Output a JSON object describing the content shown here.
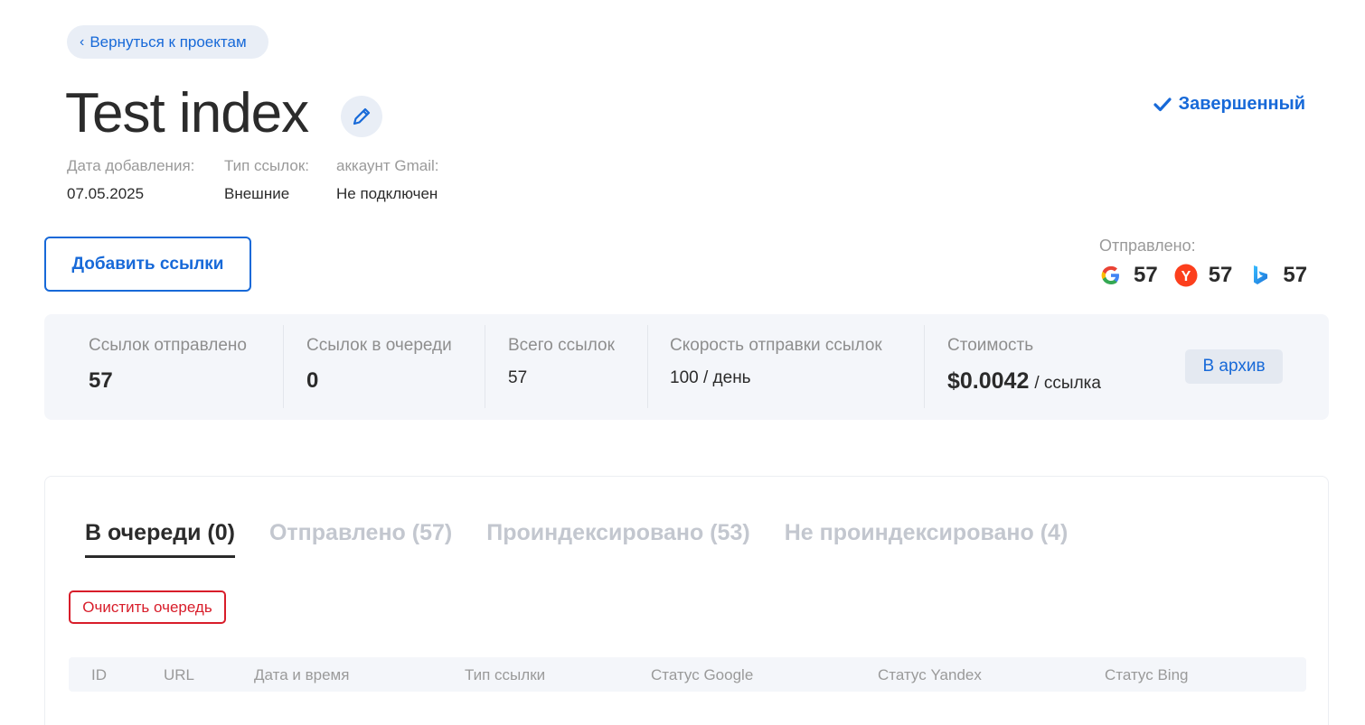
{
  "nav": {
    "back_label": "Вернуться к проектам"
  },
  "project": {
    "title": "Test index",
    "status": "Завершенный",
    "meta": [
      {
        "label": "Дата добавления:",
        "value": "07.05.2025"
      },
      {
        "label": "Тип ссылок:",
        "value": "Внешние"
      },
      {
        "label": "аккаунт Gmail:",
        "value": "Не подключен"
      }
    ]
  },
  "actions": {
    "add_links_label": "Добавить ссылки",
    "archive_label": "В архив",
    "clear_queue_label": "Очистить очередь"
  },
  "sent": {
    "label": "Отправлено:",
    "engines": [
      {
        "name": "google-icon",
        "count": "57"
      },
      {
        "name": "yandex-icon",
        "count": "57"
      },
      {
        "name": "bing-icon",
        "count": "57"
      }
    ]
  },
  "stats": {
    "links_sent": {
      "label": "Ссылок отправлено",
      "value": "57"
    },
    "links_queued": {
      "label": "Ссылок в очереди",
      "value": "0"
    },
    "links_total": {
      "label": "Всего ссылок",
      "value": "57"
    },
    "speed": {
      "label": "Скорость отправки ссылок",
      "value": "100 / день"
    },
    "cost": {
      "label": "Стоимость",
      "price": "$0.0042",
      "unit": "/ ссылка"
    }
  },
  "tabs": [
    {
      "label": "В очереди (0)",
      "active": true
    },
    {
      "label": "Отправлено (57)",
      "active": false
    },
    {
      "label": "Проиндексировано (53)",
      "active": false
    },
    {
      "label": "Не проиндексировано (4)",
      "active": false
    }
  ],
  "table": {
    "columns": [
      "ID",
      "URL",
      "Дата и время",
      "Тип ссылки",
      "Статус Google",
      "Статус Yandex",
      "Статус Bing"
    ]
  },
  "colors": {
    "accent": "#1769d8",
    "danger": "#d81d2a",
    "muted": "#9a9a9a",
    "panel_bg": "#f4f6fa"
  }
}
